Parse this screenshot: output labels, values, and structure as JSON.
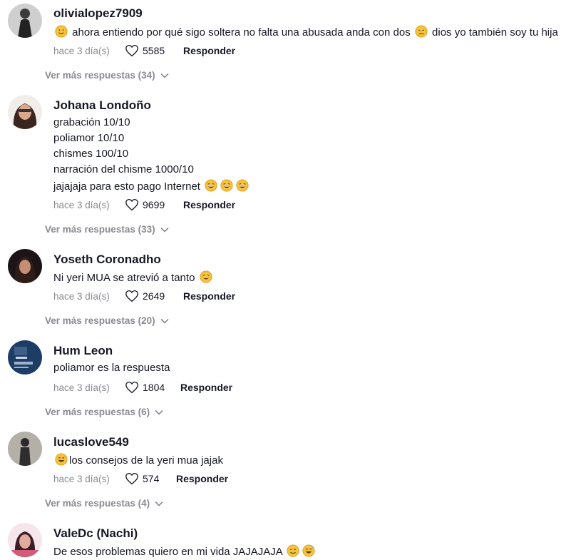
{
  "labels": {
    "reply": "Responder"
  },
  "comments": [
    {
      "username": "olivialopez7909",
      "lines": [
        " ahora entiendo por qué sigo soltera no falta una abusada anda con dos ",
        " dios yo también soy tu hija"
      ],
      "time": "hace 3 día(s)",
      "likes": "5585",
      "more_replies": "Ver más respuestas (34)",
      "emojis": [
        "smiling-face",
        "disappointed-face"
      ]
    },
    {
      "username": "Johana Londoño",
      "lines": [
        "grabación 10/10",
        "poliamor 10/10",
        "chismes 100/10",
        "narración del chisme 1000/10",
        "jajajaja para esto pago Internet "
      ],
      "time": "hace 3 día(s)",
      "likes": "9699",
      "more_replies": "Ver más respuestas (33)",
      "emojis": [
        "laughing-face",
        "laughing-face",
        "laughing-face"
      ]
    },
    {
      "username": "Yoseth Coronadho",
      "lines": [
        "Ni yeri MUA se atrevió a tanto "
      ],
      "time": "hace 3 día(s)",
      "likes": "2649",
      "more_replies": "Ver más respuestas (20)",
      "emojis": [
        "laughing-face"
      ]
    },
    {
      "username": "Hum Leon",
      "lines": [
        "poliamor es la respuesta"
      ],
      "time": "hace 3 día(s)",
      "likes": "1804",
      "more_replies": "Ver más respuestas (6)",
      "emojis": []
    },
    {
      "username": "lucaslove549",
      "lines": [
        "los consejos de la yeri mua jajak"
      ],
      "time": "hace 3 día(s)",
      "likes": "574",
      "more_replies": "Ver más respuestas (4)",
      "emojis": [
        "grinning-sweat-face"
      ]
    },
    {
      "username": "ValeDc (Nachi)",
      "lines": [
        "De esos problemas quiero en mi vida JAJAJAJA "
      ],
      "emojis": [
        "winking-face",
        "grinning-sweat-face"
      ]
    }
  ],
  "avatar_colors": [
    "#3b3b3b",
    "#5a4036",
    "#2c2226",
    "#1e3d66",
    "#6b6b66",
    "#d45a7a"
  ],
  "icons": {
    "like": "heart-outline-icon",
    "expand": "chevron-down-icon"
  }
}
